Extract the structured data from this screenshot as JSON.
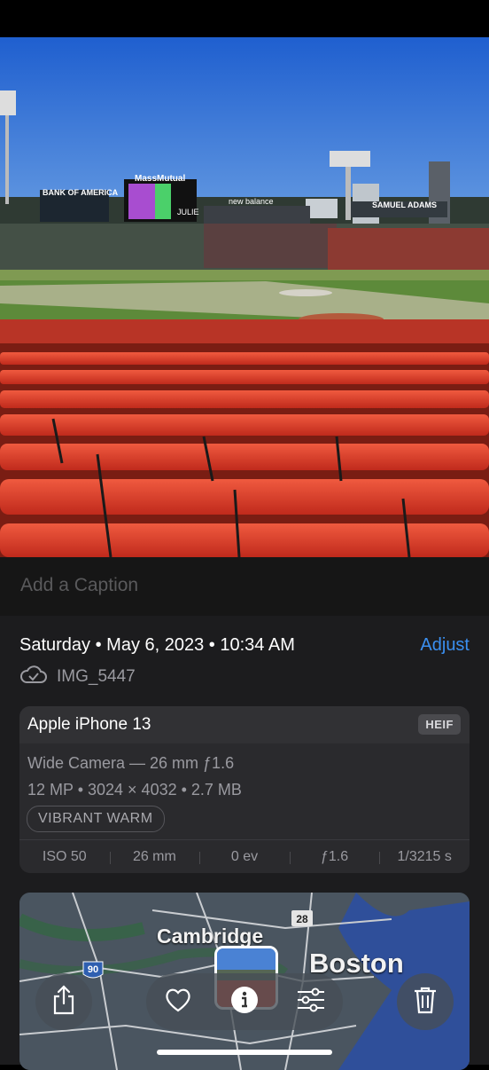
{
  "caption": {
    "placeholder": "Add a Caption"
  },
  "info": {
    "date_line": "Saturday • May 6, 2023 • 10:34 AM",
    "adjust_label": "Adjust",
    "filename": "IMG_5447",
    "cloud_icon": "cloud-check-icon"
  },
  "camera": {
    "device": "Apple iPhone 13",
    "format_badge": "HEIF",
    "lens": "Wide Camera — 26 mm ƒ1.6",
    "specs": "12 MP • 3024 × 4032 • 2.7 MB",
    "style_pill": "VIBRANT WARM",
    "exif": [
      "ISO 50",
      "26 mm",
      "0 ev",
      "ƒ1.6",
      "1/3215 s"
    ]
  },
  "map": {
    "labels": {
      "cambridge": "Cambridge",
      "boston": "Boston",
      "route_28": "28",
      "route_90": "90"
    }
  },
  "photo_signage": {
    "sign1": "BANK OF AMERICA",
    "sign2": "MassMutual",
    "sign3": "new balance",
    "sign4": "SAMUEL ADAMS",
    "sign5": "JULIE"
  },
  "toolbar": {
    "icons": [
      "share-icon",
      "heart-icon",
      "info-icon",
      "adjustments-icon",
      "trash-icon"
    ]
  },
  "colors": {
    "accent": "#3a8ff0",
    "seat_red": "#e0412a",
    "sky": "#2a6fd6"
  }
}
